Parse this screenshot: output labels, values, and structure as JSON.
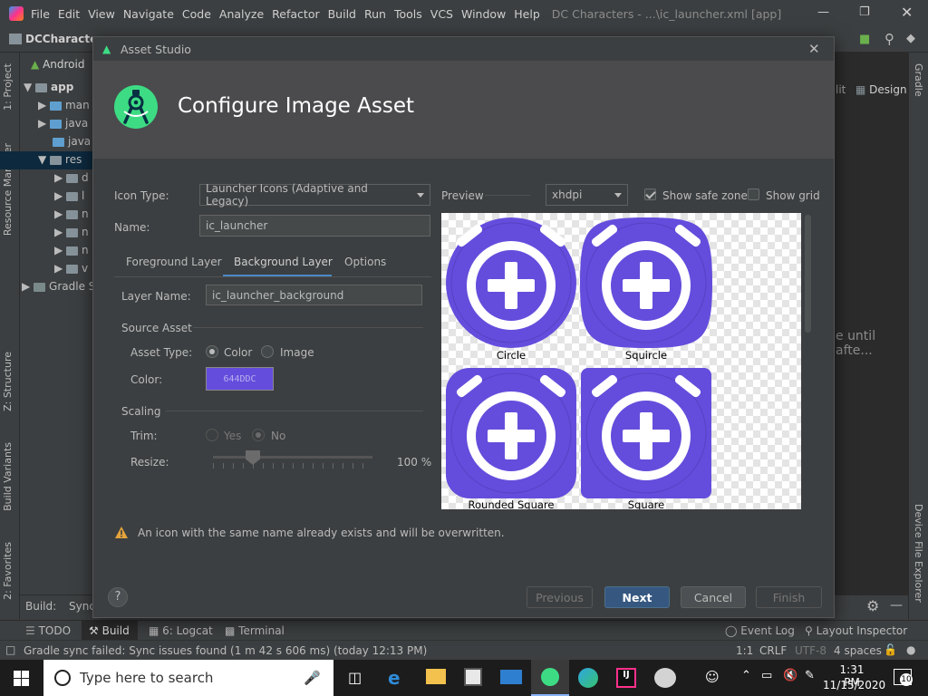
{
  "titlebar": {
    "menus": [
      "File",
      "Edit",
      "View",
      "Navigate",
      "Code",
      "Analyze",
      "Refactor",
      "Build",
      "Run",
      "Tools",
      "VCS",
      "Window",
      "Help"
    ],
    "title": "DC Characters - ...\\ic_launcher.xml [app]"
  },
  "project": {
    "name": "DCCharacters",
    "view": "Android",
    "items": [
      "app",
      "man",
      "java",
      "java",
      "res",
      "d",
      "l",
      "n",
      "n",
      "n",
      "v",
      "Gradle S"
    ]
  },
  "left_tabs": {
    "project": "1: Project",
    "resource_manager": "Resource Manager",
    "structure": "Z: Structure",
    "build_variants": "Build Variants",
    "favorites": "2: Favorites"
  },
  "right_tabs": {
    "gradle": "Gradle",
    "device_file_explorer": "Device File Explorer"
  },
  "editor": {
    "split": "lit",
    "design": "Design",
    "background_text": "e until afte..."
  },
  "build_bar": {
    "label": "Build:",
    "tab": "Sync"
  },
  "dialog": {
    "window_title": "Asset Studio",
    "heading": "Configure Image Asset",
    "icon_type_label": "Icon Type:",
    "icon_type_value": "Launcher Icons (Adaptive and Legacy)",
    "name_label": "Name:",
    "name_value": "ic_launcher",
    "tabs": [
      "Foreground Layer",
      "Background Layer",
      "Options"
    ],
    "active_tab": "Background Layer",
    "layer_name_label": "Layer Name:",
    "layer_name_value": "ic_launcher_background",
    "source_asset_label": "Source Asset",
    "asset_type_label": "Asset Type:",
    "asset_type_options": [
      "Color",
      "Image"
    ],
    "asset_type_selected": "Color",
    "color_label": "Color:",
    "color_value": "644DDC",
    "scaling_label": "Scaling",
    "trim_label": "Trim:",
    "trim_options": [
      "Yes",
      "No"
    ],
    "trim_selected": "No",
    "resize_label": "Resize:",
    "resize_value": "100 %",
    "resize_percent": 100,
    "preview_label": "Preview",
    "density_value": "xhdpi",
    "show_safe_zone_label": "Show safe zone",
    "show_safe_zone": true,
    "show_grid_label": "Show grid",
    "show_grid": false,
    "preview_shapes": [
      "Circle",
      "Squircle",
      "Rounded Square",
      "Square"
    ],
    "warning": "An icon with the same name already exists and will be overwritten.",
    "buttons": {
      "help": "?",
      "previous": "Previous",
      "next": "Next",
      "cancel": "Cancel",
      "finish": "Finish"
    },
    "accent_color": "#644ddc"
  },
  "bottom_tabs": {
    "todo": "TODO",
    "build": "Build",
    "logcat": "6: Logcat",
    "terminal": "Terminal",
    "event_log": "Event Log",
    "layout_inspector": "Layout Inspector"
  },
  "status": {
    "message": "Gradle sync failed: Sync issues found (1 m 42 s 606 ms) (today 12:13 PM)",
    "position": "1:1",
    "line_sep": "CRLF",
    "encoding": "UTF-8",
    "indent": "4 spaces"
  },
  "taskbar": {
    "search_placeholder": "Type here to search",
    "time": "1:31 PM",
    "date": "11/15/2020",
    "notifications": "10"
  }
}
